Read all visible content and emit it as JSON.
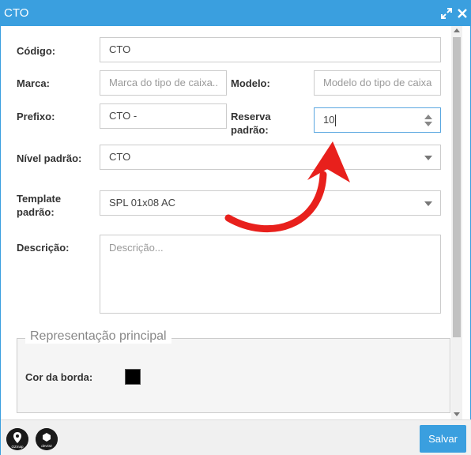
{
  "window": {
    "title": "CTO"
  },
  "form": {
    "codigo": {
      "label": "Código:",
      "value": "CTO"
    },
    "marca": {
      "label": "Marca:",
      "placeholder": "Marca do tipo de caixa.."
    },
    "modelo": {
      "label": "Modelo:",
      "placeholder": "Modelo do tipo de caixa"
    },
    "prefixo": {
      "label": "Prefixo:",
      "value": "CTO -"
    },
    "reserva": {
      "label_line1": "Reserva",
      "label_line2": "padrão:",
      "value": "10"
    },
    "nivel": {
      "label": "Nível padrão:",
      "value": "CTO"
    },
    "template": {
      "label_line1": "Template",
      "label_line2": "padrão:",
      "value": "SPL 01x08 AC"
    },
    "descricao": {
      "label": "Descrição:",
      "placeholder": "Descrição..."
    }
  },
  "representacao": {
    "legend": "Representação principal",
    "cor_borda_label": "Cor da borda:",
    "cor_borda_color": "#000000"
  },
  "footer": {
    "save_label": "Salvar",
    "logo1_text": "OZmap",
    "logo2_text": "devOZ"
  },
  "colors": {
    "accent": "#3a9fdf",
    "annotation_arrow": "#e8201c"
  }
}
